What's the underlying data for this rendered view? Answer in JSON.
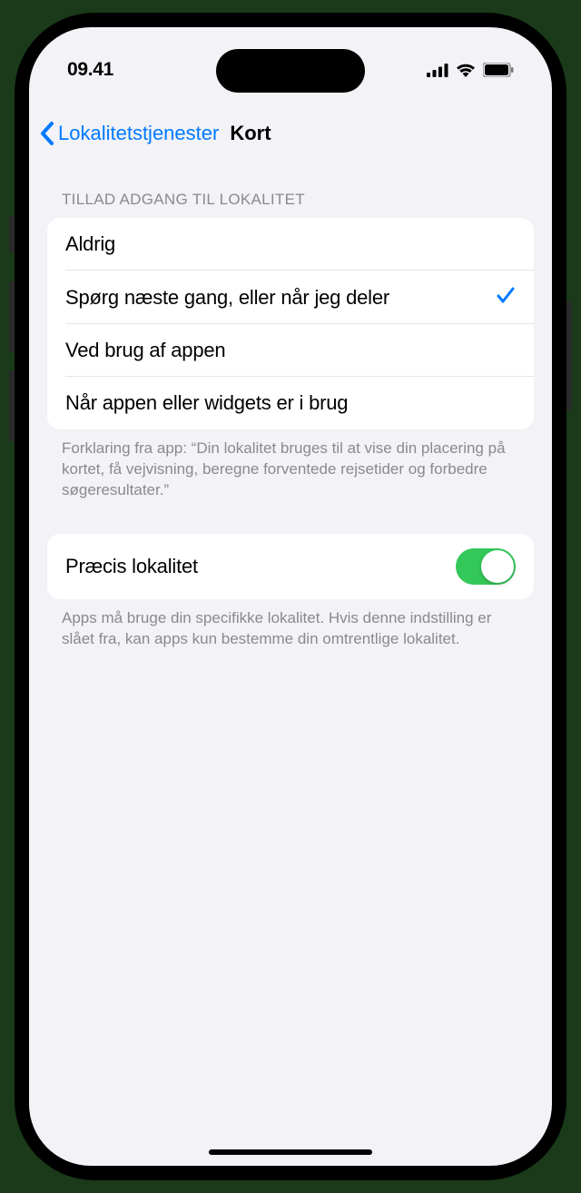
{
  "status": {
    "time": "09.41"
  },
  "nav": {
    "back_label": "Lokalitetstjenester",
    "title": "Kort"
  },
  "section1": {
    "header": "TILLAD ADGANG TIL LOKALITET",
    "options": [
      {
        "label": "Aldrig",
        "selected": false
      },
      {
        "label": "Spørg næste gang, eller når jeg deler",
        "selected": true
      },
      {
        "label": "Ved brug af appen",
        "selected": false
      },
      {
        "label": "Når appen eller widgets er i brug",
        "selected": false
      }
    ],
    "footer": "Forklaring fra app: “Din lokalitet bruges til at vise din placering på kortet, få vejvisning, beregne forventede rejsetider og forbedre søgeresultater.”"
  },
  "section2": {
    "precise_label": "Præcis lokalitet",
    "precise_enabled": true,
    "footer": "Apps må bruge din specifikke lokalitet. Hvis denne indstilling er slået fra, kan apps kun bestemme din omtrentlige lokalitet."
  }
}
